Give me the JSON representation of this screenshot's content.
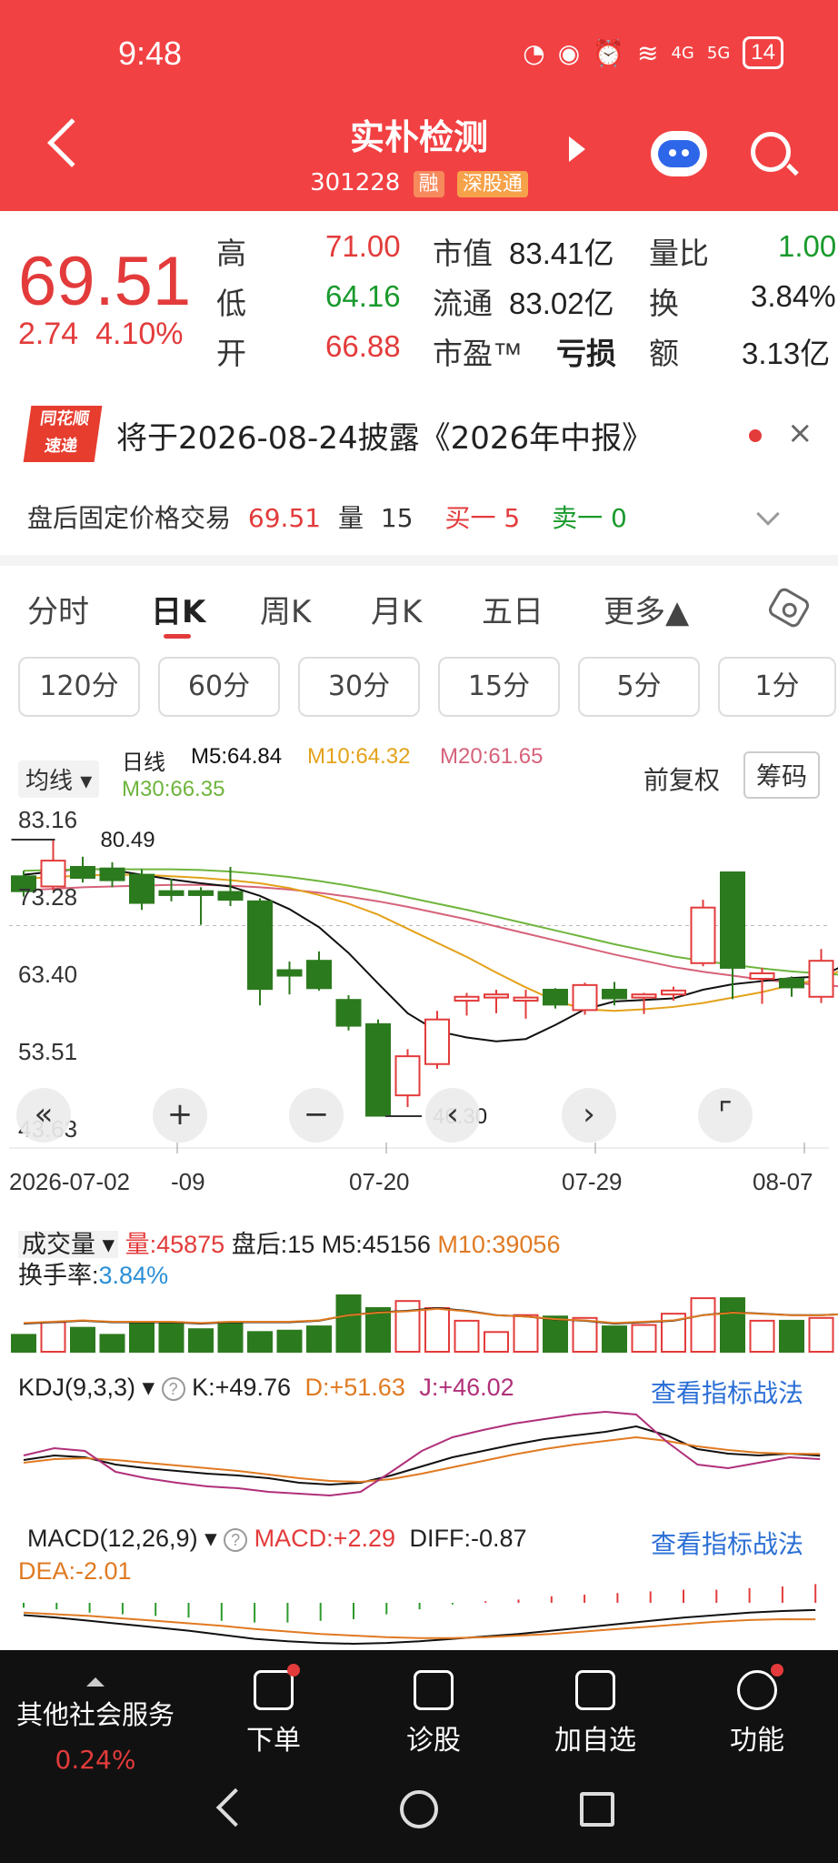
{
  "status_bar": {
    "time": "9:48",
    "battery": "14",
    "signal_a": "4G",
    "signal_b": "5G"
  },
  "header": {
    "stock_name": "实朴检测",
    "stock_code": "301228",
    "tag_margin": "融",
    "tag_connect": "深股通"
  },
  "quote": {
    "price": "69.51",
    "change": "2.74",
    "change_pct": "4.10%",
    "high_label": "高",
    "high_value": "71.00",
    "low_label": "低",
    "low_value": "64.16",
    "open_label": "开",
    "open_value": "66.88",
    "mktcap_label": "市值",
    "mktcap_value": "83.41亿",
    "float_label": "流通",
    "float_value": "83.02亿",
    "pe_label": "市盈™",
    "pe_value": "亏损",
    "vol_ratio_label": "量比",
    "vol_ratio_value": "1.00",
    "turnover_label": "换",
    "turnover_value": "3.84%",
    "amount_label": "额",
    "amount_value": "3.13亿"
  },
  "notice": {
    "logo_top": "同花顺",
    "logo_bottom": "速递",
    "text": "将于2026-08-24披露《2026年中报》"
  },
  "after_hours": {
    "label": "盘后固定价格交易",
    "price": "69.51",
    "vol_label": "量",
    "vol": "15",
    "buy": "买一 5",
    "sell": "卖一 0"
  },
  "tabs": [
    "分时",
    "日K",
    "周K",
    "月K",
    "五日",
    "更多▲"
  ],
  "periods": [
    "120分",
    "60分",
    "30分",
    "15分",
    "5分",
    "1分"
  ],
  "ma_legend": {
    "selector": "均线",
    "daily": "日线",
    "m5": "M5:64.84",
    "m10": "M10:64.32",
    "m20": "M20:61.65",
    "m30": "M30:66.35",
    "fuquan": "前复权",
    "chips": "筹码"
  },
  "colors": {
    "up": "#e33b3b",
    "down": "#2c7a1e",
    "m5": "#111111",
    "m10": "#e3a21a",
    "m20": "#d6627a",
    "m30": "#6fb53d"
  },
  "chart_data": [
    {
      "type": "candlestick",
      "y_ticks": [
        "83.16",
        "73.28",
        "63.40",
        "53.51",
        "43.63"
      ],
      "ylim": [
        43.63,
        83.16
      ],
      "dates": [
        "2026-07-02",
        "-09",
        "07-20",
        "07-29",
        "08-07"
      ],
      "annotations": [
        {
          "label": "80.49"
        },
        {
          "label": "46.30"
        }
      ],
      "candles": [
        {
          "o": 75.8,
          "c": 73.9,
          "h": 76.5,
          "l": 73.2
        },
        {
          "o": 74.5,
          "c": 77.8,
          "h": 80.49,
          "l": 74.0
        },
        {
          "o": 77.0,
          "c": 75.6,
          "h": 78.3,
          "l": 75.0
        },
        {
          "o": 76.8,
          "c": 75.3,
          "h": 77.6,
          "l": 74.4
        },
        {
          "o": 76.0,
          "c": 72.4,
          "h": 76.7,
          "l": 71.5
        },
        {
          "o": 73.9,
          "c": 73.4,
          "h": 75.5,
          "l": 72.6
        },
        {
          "o": 73.9,
          "c": 73.4,
          "h": 74.4,
          "l": 69.6
        },
        {
          "o": 73.8,
          "c": 72.8,
          "h": 77.0,
          "l": 72.0
        },
        {
          "o": 72.6,
          "c": 61.4,
          "h": 73.0,
          "l": 59.3
        },
        {
          "o": 63.8,
          "c": 63.1,
          "h": 64.9,
          "l": 60.7
        },
        {
          "o": 65.0,
          "c": 61.5,
          "h": 66.2,
          "l": 61.2
        },
        {
          "o": 60.0,
          "c": 56.7,
          "h": 60.6,
          "l": 56.1
        },
        {
          "o": 56.9,
          "c": 45.2,
          "h": 57.5,
          "l": 45.2
        },
        {
          "o": 47.8,
          "c": 52.8,
          "h": 53.7,
          "l": 46.3
        },
        {
          "o": 51.8,
          "c": 57.5,
          "h": 58.6,
          "l": 51.2
        },
        {
          "o": 59.9,
          "c": 60.4,
          "h": 60.9,
          "l": 58.0
        },
        {
          "o": 60.3,
          "c": 60.7,
          "h": 61.3,
          "l": 58.3
        },
        {
          "o": 59.9,
          "c": 60.3,
          "h": 61.3,
          "l": 57.6
        },
        {
          "o": 61.3,
          "c": 59.4,
          "h": 61.5,
          "l": 58.9
        },
        {
          "o": 58.7,
          "c": 61.9,
          "h": 62.2,
          "l": 58.1
        },
        {
          "o": 61.3,
          "c": 60.2,
          "h": 62.3,
          "l": 59.3
        },
        {
          "o": 60.3,
          "c": 60.7,
          "h": 60.9,
          "l": 58.2
        },
        {
          "o": 60.7,
          "c": 61.2,
          "h": 61.7,
          "l": 59.9
        },
        {
          "o": 64.7,
          "c": 71.8,
          "h": 72.8,
          "l": 64.3
        },
        {
          "o": 76.3,
          "c": 64.1,
          "h": 76.3,
          "l": 60.1
        },
        {
          "o": 62.7,
          "c": 63.4,
          "h": 64.1,
          "l": 59.5
        },
        {
          "o": 62.7,
          "c": 61.6,
          "h": 63.0,
          "l": 60.4
        },
        {
          "o": 60.4,
          "c": 65.0,
          "h": 66.5,
          "l": 59.6
        },
        {
          "o": 67.2,
          "c": 69.5,
          "h": 71.0,
          "l": 64.2
        }
      ],
      "ma5": [
        76.0,
        76.4,
        76.8,
        76.6,
        76.0,
        75.4,
        74.9,
        74.5,
        73.3,
        71.6,
        69.3,
        66.0,
        62.1,
        58.3,
        56.0,
        55.2,
        54.7,
        55.0,
        56.8,
        58.8,
        59.8,
        60.0,
        60.2,
        61.3,
        62.0,
        62.4,
        62.8,
        63.0,
        64.84
      ],
      "ma10": [
        75.5,
        75.7,
        75.9,
        76.0,
        76.0,
        75.8,
        75.6,
        75.3,
        74.9,
        74.3,
        73.4,
        72.3,
        70.9,
        69.1,
        67.3,
        65.5,
        63.5,
        61.6,
        59.9,
        58.8,
        58.6,
        58.8,
        59.1,
        59.6,
        60.3,
        61.0,
        61.9,
        62.7,
        64.32
      ],
      "ma20": [
        74.0,
        74.2,
        74.4,
        74.5,
        74.6,
        74.7,
        74.7,
        74.6,
        74.4,
        74.1,
        73.7,
        73.2,
        72.6,
        71.9,
        71.1,
        70.3,
        69.4,
        68.5,
        67.6,
        66.7,
        65.8,
        65.0,
        64.2,
        63.6,
        63.1,
        62.6,
        62.2,
        61.9,
        61.65
      ]
    },
    {
      "type": "bar",
      "title": "成交量",
      "series": [
        {
          "name": "量",
          "values": [
            12,
            21,
            17,
            12,
            21,
            21,
            16,
            21,
            14,
            15,
            18,
            40,
            31,
            36,
            31,
            22,
            14,
            26,
            25,
            24,
            18,
            19,
            27,
            38,
            38,
            22,
            22,
            24,
            25
          ]
        }
      ],
      "ma5": [
        20,
        21,
        22,
        21,
        21,
        21,
        20,
        21,
        21,
        21,
        22,
        26,
        28,
        29,
        31,
        29,
        26,
        25,
        23,
        22,
        20,
        21,
        22,
        26,
        28,
        27,
        26,
        26,
        27
      ]
    },
    {
      "type": "line",
      "title": "KDJ(9,3,3)",
      "series": [
        {
          "name": "K",
          "values": [
            45,
            50,
            48,
            40,
            36,
            33,
            30,
            28,
            25,
            20,
            18,
            20,
            28,
            38,
            48,
            55,
            62,
            68,
            72,
            76,
            82,
            72,
            57,
            52,
            50,
            52,
            49.76
          ]
        },
        {
          "name": "D",
          "values": [
            42,
            46,
            47,
            45,
            42,
            39,
            36,
            33,
            29,
            25,
            22,
            21,
            24,
            30,
            37,
            44,
            51,
            57,
            62,
            66,
            70,
            66,
            60,
            56,
            53,
            52,
            51.63
          ]
        },
        {
          "name": "J",
          "values": [
            50,
            58,
            55,
            32,
            25,
            20,
            16,
            14,
            10,
            8,
            6,
            10,
            32,
            55,
            70,
            78,
            85,
            90,
            95,
            98,
            95,
            65,
            40,
            36,
            42,
            48,
            46.02
          ]
        }
      ]
    },
    {
      "type": "line",
      "title": "MACD(12,26,9)",
      "series": [
        {
          "name": "DIFF",
          "values": [
            -1.5,
            -1.8,
            -2.2,
            -2.6,
            -3.0,
            -3.4,
            -3.9,
            -4.4,
            -4.7,
            -4.9,
            -5.0,
            -4.9,
            -4.7,
            -4.4,
            -4.1,
            -3.8,
            -3.4,
            -3.0,
            -2.6,
            -2.2,
            -1.8,
            -1.5,
            -1.2,
            -1.0,
            -0.87
          ]
        },
        {
          "name": "DEA",
          "values": [
            -1.2,
            -1.4,
            -1.6,
            -1.9,
            -2.2,
            -2.5,
            -2.8,
            -3.2,
            -3.5,
            -3.8,
            -4.0,
            -4.2,
            -4.3,
            -4.3,
            -4.2,
            -4.0,
            -3.8,
            -3.5,
            -3.2,
            -2.9,
            -2.6,
            -2.3,
            -2.1,
            -2.0,
            -2.01
          ]
        },
        {
          "name": "MACD",
          "values": [
            -0.6,
            -0.8,
            -1.2,
            -1.4,
            -1.6,
            -1.8,
            -2.2,
            -2.4,
            -2.4,
            -2.2,
            -2.0,
            -1.4,
            -0.8,
            -0.2,
            0.2,
            0.4,
            0.8,
            1.0,
            1.2,
            1.4,
            1.6,
            1.6,
            1.8,
            2.0,
            2.29
          ]
        }
      ]
    }
  ],
  "volume": {
    "selector": "成交量",
    "vol": "量:45875",
    "after": "盘后:15",
    "m5": "M5:45156",
    "m10": "M10:39056",
    "turnover_label": "换手率:",
    "turnover": "3.84%"
  },
  "kdj": {
    "selector": "KDJ(9,3,3)",
    "k": "K:+49.76",
    "d": "D:+51.63",
    "j": "J:+46.02",
    "link": "查看指标战法"
  },
  "macd": {
    "selector": "MACD(12,26,9)",
    "macd": "MACD:+2.29",
    "diff": "DIFF:-0.87",
    "dea": "DEA:-2.01",
    "link": "查看指标战法"
  },
  "bottom": {
    "sector": "其他社会服务",
    "sector_pct": "0.24%",
    "items": [
      "下单",
      "诊股",
      "加自选",
      "功能"
    ]
  }
}
